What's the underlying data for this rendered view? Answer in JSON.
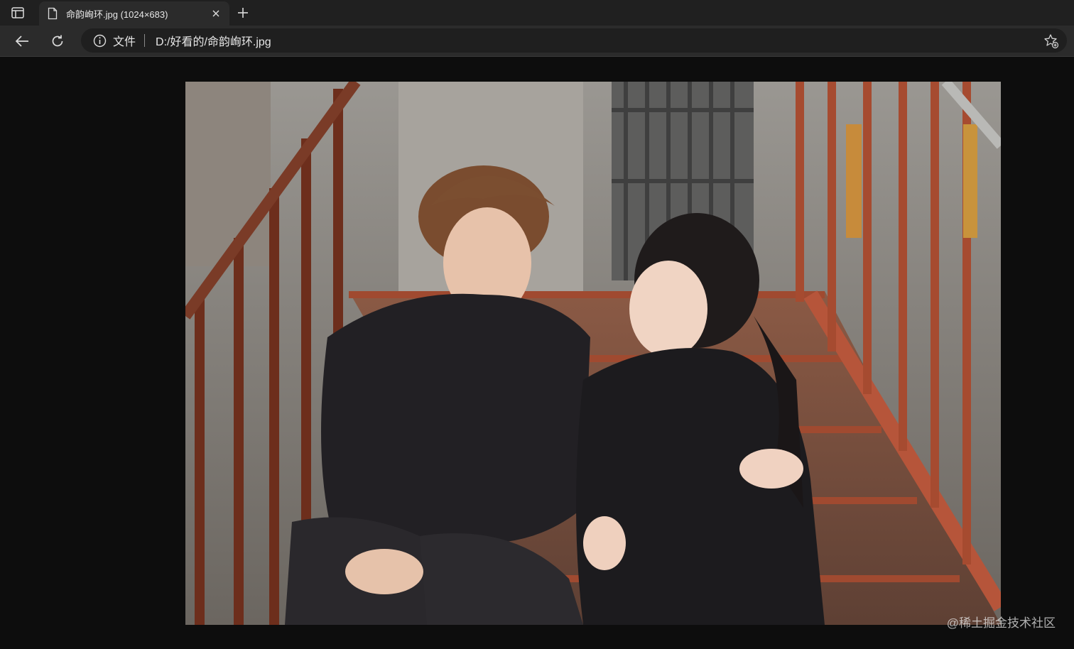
{
  "tab": {
    "title": "命韵峋环.jpg (1024×683)"
  },
  "address_bar": {
    "scheme_label": "文件",
    "url": "D:/好看的/命韵峋环.jpg"
  },
  "icons": {
    "tab_actions": "tab-actions-icon",
    "file": "file-icon",
    "close": "close-icon",
    "new_tab": "plus-icon",
    "back": "back-arrow-icon",
    "reload": "reload-icon",
    "info": "info-icon",
    "favorite": "star-add-icon"
  },
  "image": {
    "natural_width": 1024,
    "natural_height": 683
  },
  "watermark": "@稀土掘金技术社区",
  "colors": {
    "tabstrip": "#202020",
    "toolbar": "#2b2b2b",
    "omnibox": "#1f1f1f",
    "viewer_background": "#0d0d0d",
    "text": "#e6e6e6"
  }
}
